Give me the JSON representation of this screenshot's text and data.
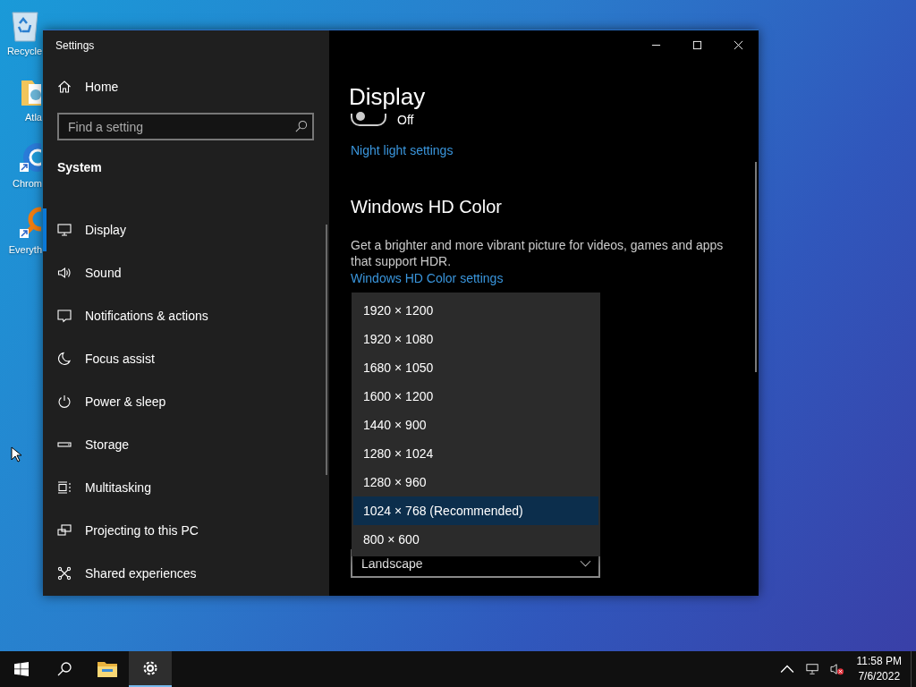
{
  "desktop_icons": [
    {
      "label": "Recycle"
    },
    {
      "label": "Atla"
    },
    {
      "label": "Chrom"
    },
    {
      "label": "Everyth"
    }
  ],
  "window": {
    "title": "Settings",
    "sidebar": {
      "home": "Home",
      "search": {
        "placeholder": "Find a setting"
      },
      "section": "System",
      "items": [
        {
          "label": "Display",
          "selected": true
        },
        {
          "label": "Sound",
          "selected": false
        },
        {
          "label": "Notifications & actions",
          "selected": false
        },
        {
          "label": "Focus assist",
          "selected": false
        },
        {
          "label": "Power & sleep",
          "selected": false
        },
        {
          "label": "Storage",
          "selected": false
        },
        {
          "label": "Multitasking",
          "selected": false
        },
        {
          "label": "Projecting to this PC",
          "selected": false
        },
        {
          "label": "Shared experiences",
          "selected": false
        }
      ]
    },
    "content": {
      "title": "Display",
      "night_light_toggle": {
        "on": false,
        "state_label": "Off"
      },
      "night_light_link": "Night light settings",
      "hd_color_heading": "Windows HD Color",
      "hd_color_text": "Get a brighter and more vibrant picture for videos, games and apps that support HDR.",
      "hd_color_link": "Windows HD Color settings",
      "resolution_menu": [
        {
          "label": "1920 × 1200",
          "selected": false
        },
        {
          "label": "1920 × 1080",
          "selected": false
        },
        {
          "label": "1680 × 1050",
          "selected": false
        },
        {
          "label": "1600 × 1200",
          "selected": false
        },
        {
          "label": "1440 × 900",
          "selected": false
        },
        {
          "label": "1280 × 1024",
          "selected": false
        },
        {
          "label": "1280 × 960",
          "selected": false
        },
        {
          "label": "1024 × 768 (Recommended)",
          "selected": true
        },
        {
          "label": "800 × 600",
          "selected": false
        }
      ],
      "orientation_select": {
        "value": "Landscape"
      }
    }
  },
  "taskbar": {
    "time": "11:58 PM",
    "date": "7/6/2022"
  }
}
